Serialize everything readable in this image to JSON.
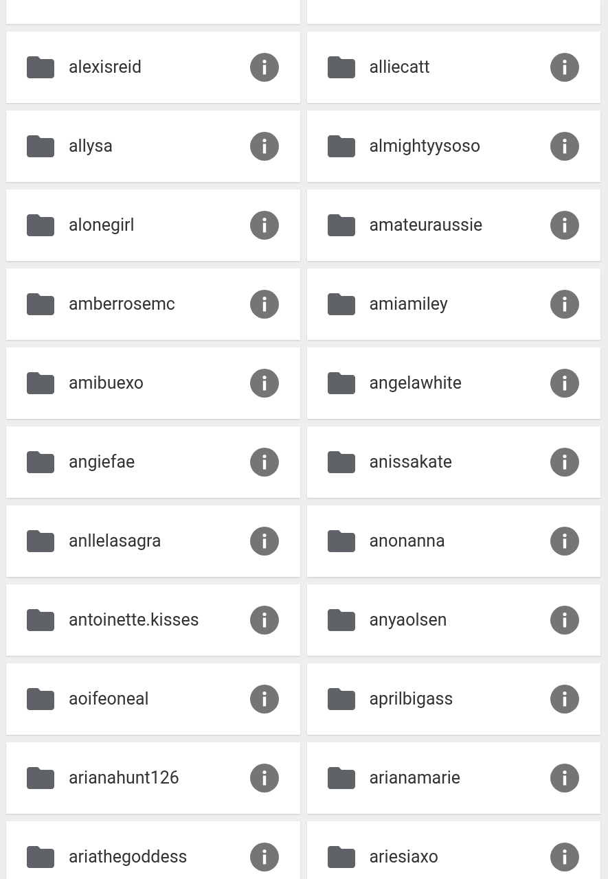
{
  "folders": [
    {
      "name": "alexisreid"
    },
    {
      "name": "alliecatt"
    },
    {
      "name": "allysa"
    },
    {
      "name": "almightyysoso"
    },
    {
      "name": "alonegirl"
    },
    {
      "name": "amateuraussie"
    },
    {
      "name": "amberrosemc"
    },
    {
      "name": "amiamiley"
    },
    {
      "name": "amibuexo"
    },
    {
      "name": "angelawhite"
    },
    {
      "name": "angiefae"
    },
    {
      "name": "anissakate"
    },
    {
      "name": "anllelasagra"
    },
    {
      "name": "anonanna"
    },
    {
      "name": "antoinette.kisses"
    },
    {
      "name": "anyaolsen"
    },
    {
      "name": "aoifeoneal"
    },
    {
      "name": "aprilbigass"
    },
    {
      "name": "arianahunt126"
    },
    {
      "name": "arianamarie"
    },
    {
      "name": "ariathegoddess"
    },
    {
      "name": "ariesiaxo"
    }
  ]
}
